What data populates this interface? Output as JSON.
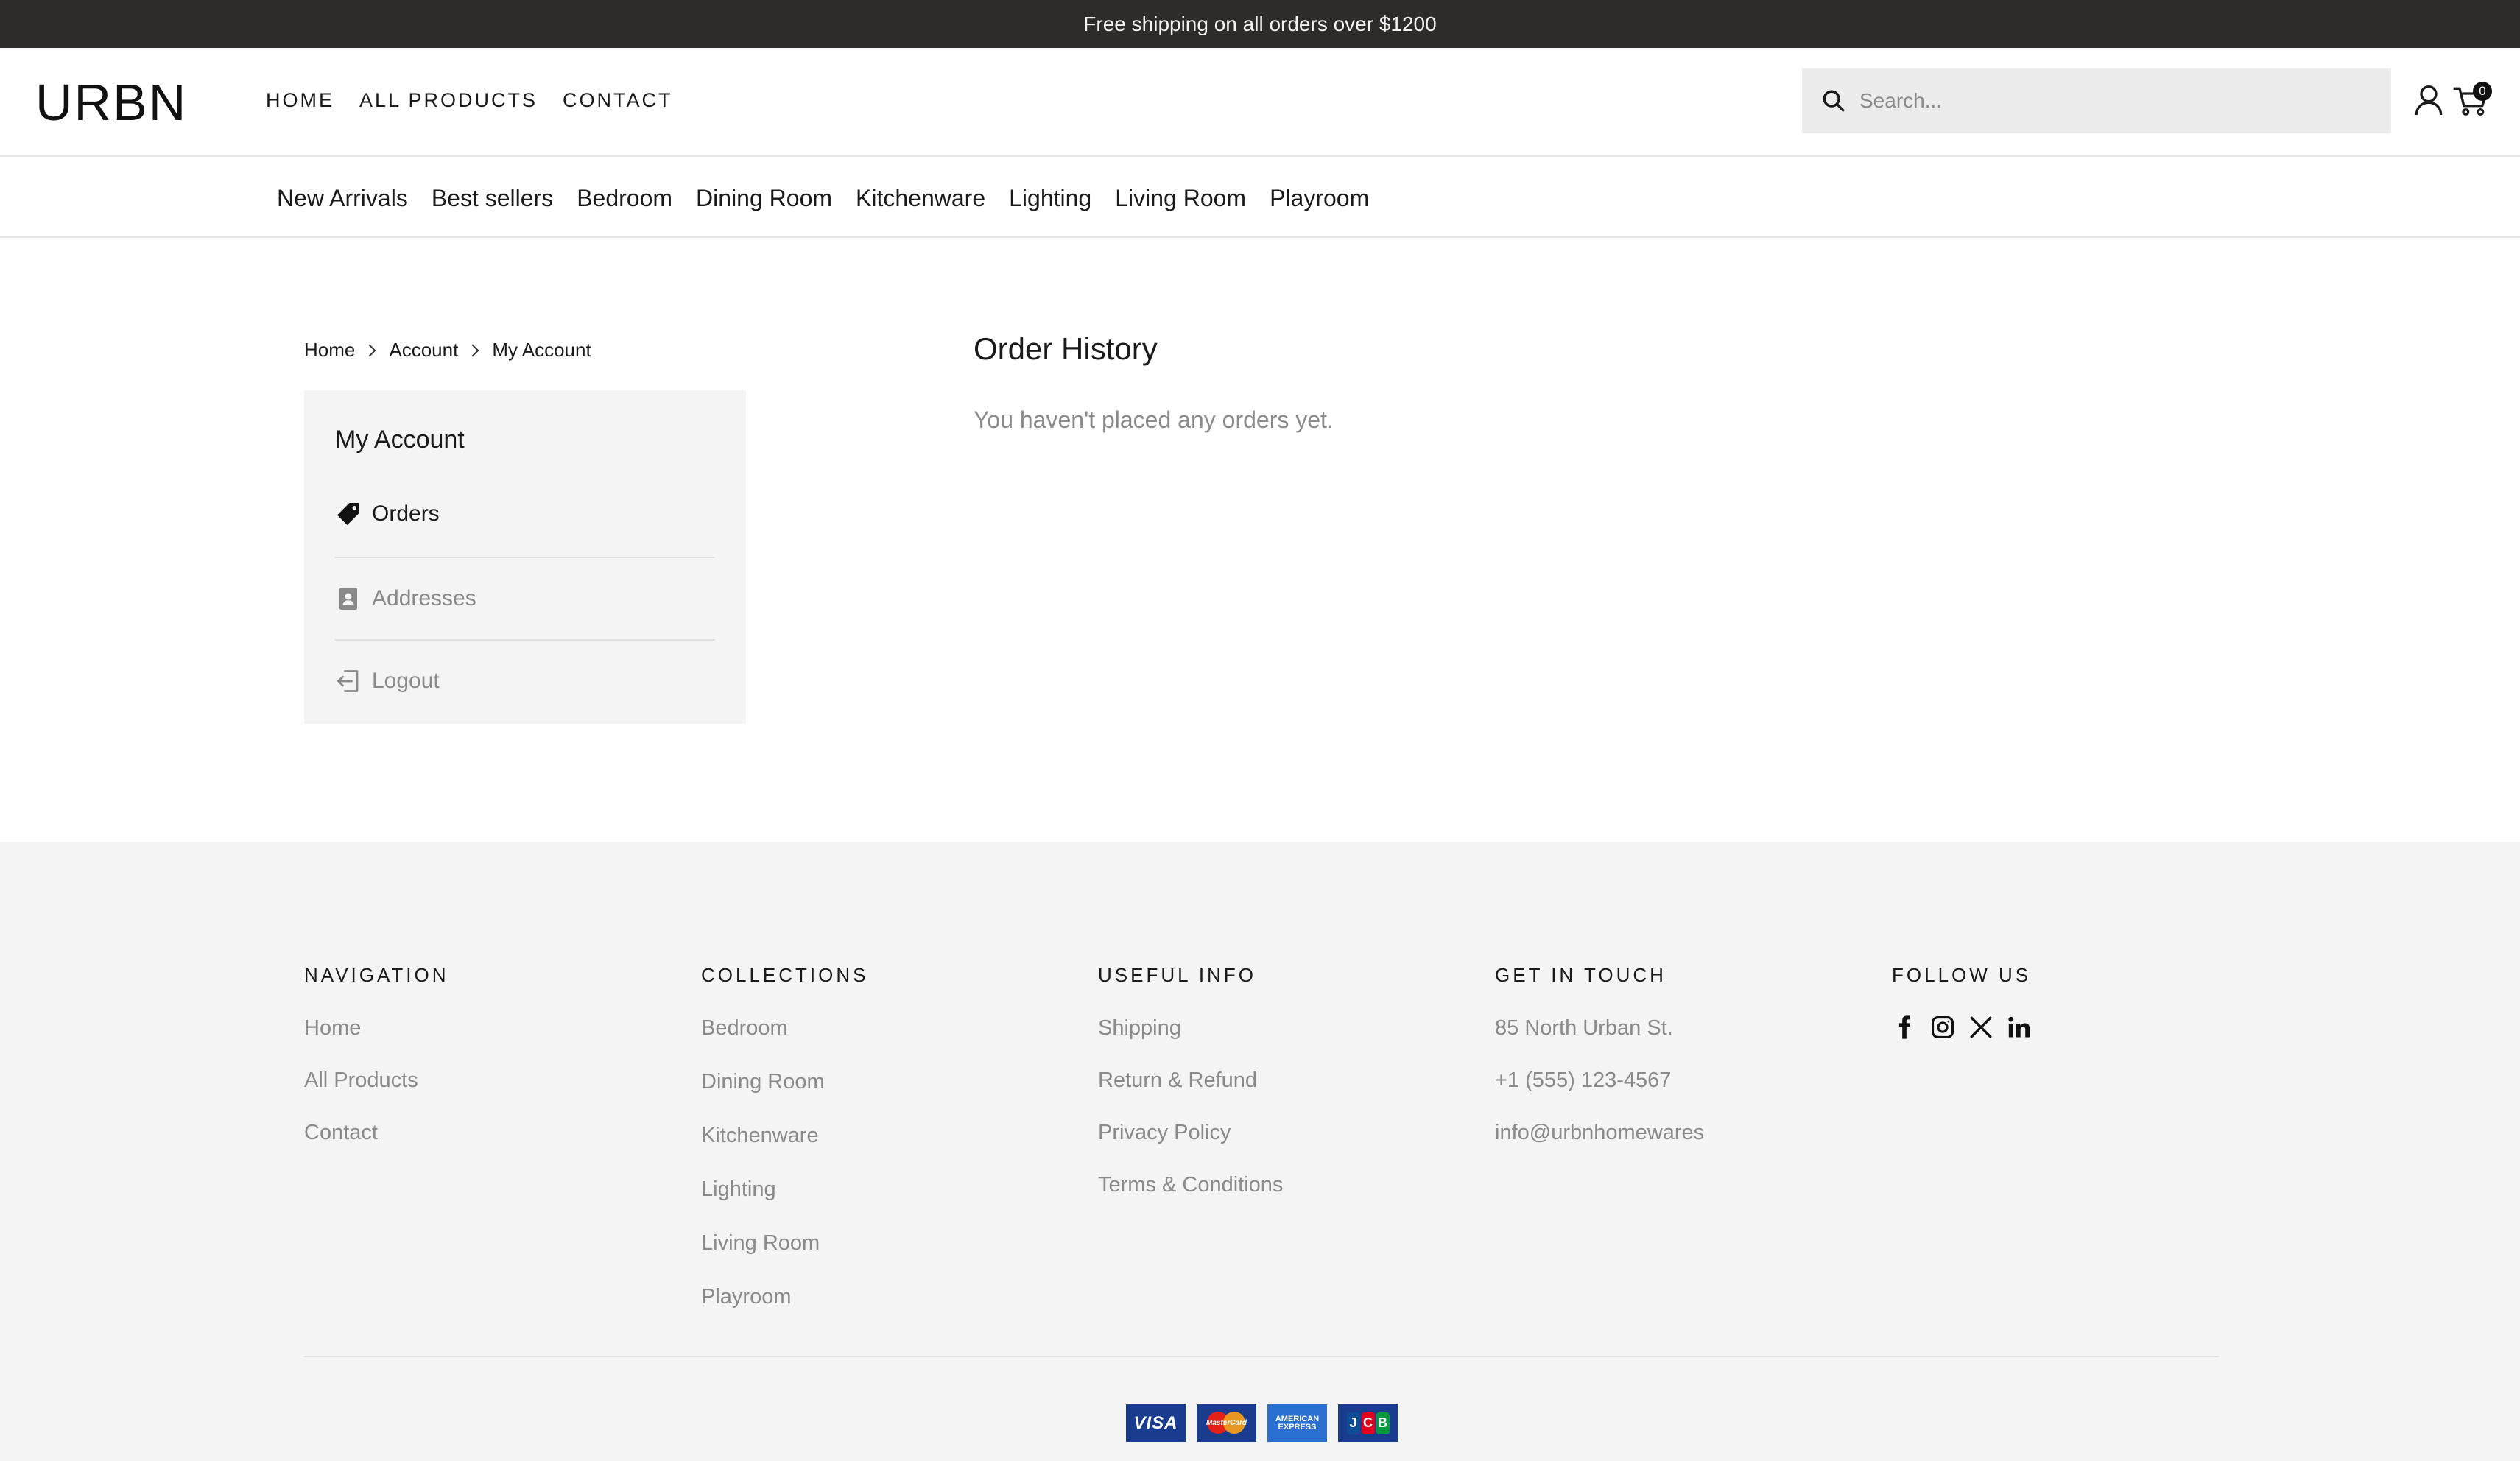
{
  "announcement": "Free shipping on all orders over $1200",
  "header": {
    "logo": "URBN",
    "nav": [
      "HOME",
      "ALL PRODUCTS",
      "CONTACT"
    ],
    "search_placeholder": "Search...",
    "cart_count": "0"
  },
  "categories": [
    "New Arrivals",
    "Best sellers",
    "Bedroom",
    "Dining Room",
    "Kitchenware",
    "Lighting",
    "Living Room",
    "Playroom"
  ],
  "breadcrumb": [
    "Home",
    "Account",
    "My Account"
  ],
  "account": {
    "title": "My Account",
    "items": [
      {
        "label": "Orders",
        "icon": "tag-icon"
      },
      {
        "label": "Addresses",
        "icon": "address-book-icon"
      },
      {
        "label": "Logout",
        "icon": "logout-icon"
      }
    ]
  },
  "orders": {
    "title": "Order History",
    "empty_message": "You haven't placed any orders yet."
  },
  "footer": {
    "navigation": {
      "heading": "NAVIGATION",
      "links": [
        "Home",
        "All Products",
        "Contact"
      ]
    },
    "collections": {
      "heading": "COLLECTIONS",
      "links": [
        "Bedroom",
        "Dining Room",
        "Kitchenware",
        "Lighting",
        "Living Room",
        "Playroom"
      ]
    },
    "useful_info": {
      "heading": "USEFUL INFO",
      "links": [
        "Shipping",
        "Return & Refund",
        "Privacy Policy",
        "Terms & Conditions"
      ]
    },
    "get_in_touch": {
      "heading": "GET IN TOUCH",
      "lines": [
        "85 North Urban St.",
        "+1 (555) 123-4567",
        "info@urbnhomewares"
      ]
    },
    "follow_us": {
      "heading": "FOLLOW US",
      "socials": [
        "facebook-icon",
        "instagram-icon",
        "x-icon",
        "linkedin-icon"
      ]
    },
    "payments": {
      "visa": "VISA",
      "mastercard": "MasterCard",
      "amex_line1": "AMERICAN",
      "amex_line2": "EXPRESS",
      "jcb": [
        "J",
        "C",
        "B"
      ]
    }
  },
  "colors": {
    "announcement_bg": "#2e2c2b",
    "footer_bg": "#f4f4f4",
    "panel_bg": "#f4f4f4",
    "muted_text": "#8a8a8a",
    "search_bg": "#ececec"
  }
}
